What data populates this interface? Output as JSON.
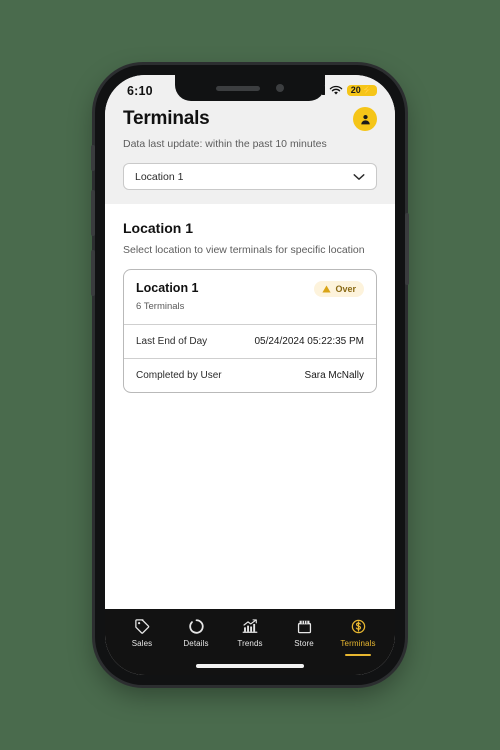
{
  "status_bar": {
    "time": "6:10",
    "cellular_icon": "signal-bars-icon",
    "wifi_icon": "wifi-icon",
    "battery_level": "20",
    "battery_charging_glyph": "⚡"
  },
  "header": {
    "title": "Terminals",
    "avatar_icon": "user-avatar-icon",
    "subtitle": "Data last update: within the past 10 minutes",
    "location_select": {
      "value": "Location 1",
      "chevron_icon": "chevron-down-icon"
    }
  },
  "main": {
    "section_title": "Location 1",
    "section_subtitle": "Select location to view terminals for specific location",
    "card": {
      "name": "Location 1",
      "terminal_count": "6 Terminals",
      "badge": {
        "label": "Over",
        "icon": "warning-triangle-icon",
        "bg_color": "#fdf3dc",
        "text_color": "#8a6a15"
      },
      "rows": [
        {
          "label": "Last End of Day",
          "value": "05/24/2024 05:22:35 PM"
        },
        {
          "label": "Completed by User",
          "value": "Sara McNally"
        }
      ]
    }
  },
  "tabbar": {
    "active_color": "#e8b730",
    "items": [
      {
        "label": "Sales",
        "icon": "price-tag-icon",
        "active": false
      },
      {
        "label": "Details",
        "icon": "donut-chart-icon",
        "active": false
      },
      {
        "label": "Trends",
        "icon": "bar-trend-icon",
        "active": false
      },
      {
        "label": "Store",
        "icon": "storefront-icon",
        "active": false
      },
      {
        "label": "Terminals",
        "icon": "dollar-circle-icon",
        "active": true
      }
    ]
  }
}
